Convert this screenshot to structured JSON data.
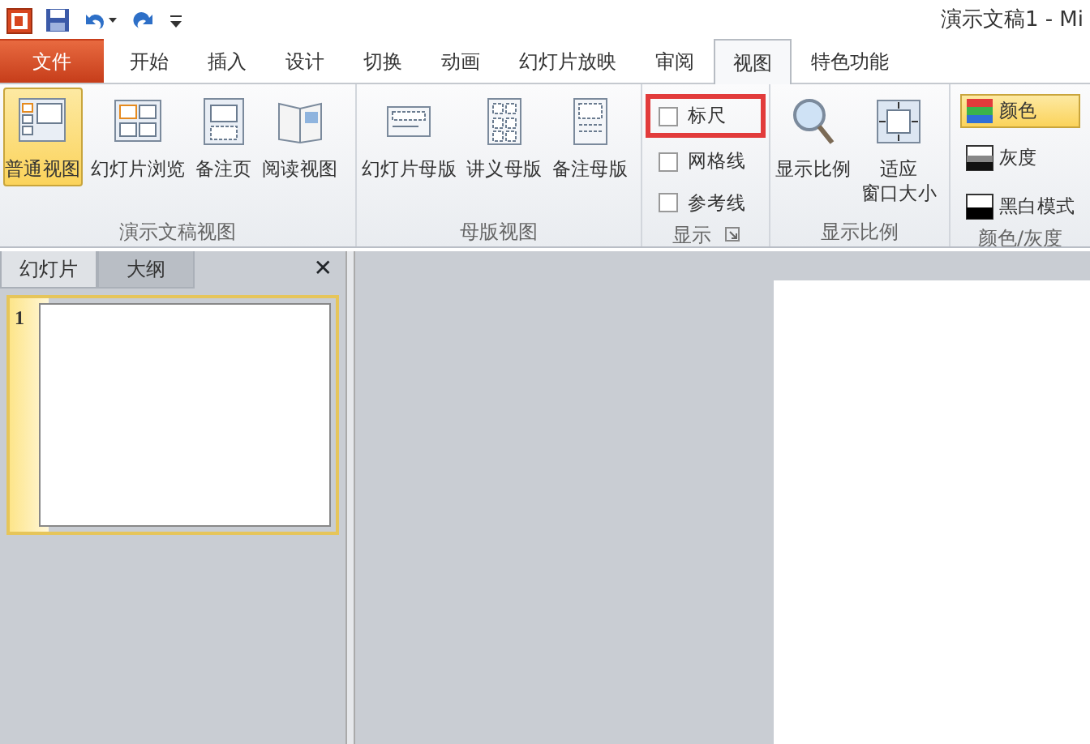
{
  "window": {
    "title": "演示文稿1 - Mi"
  },
  "tabs": [
    {
      "label": "文件",
      "kind": "file",
      "selected": false
    },
    {
      "label": "开始",
      "kind": "tab",
      "selected": false
    },
    {
      "label": "插入",
      "kind": "tab",
      "selected": false
    },
    {
      "label": "设计",
      "kind": "tab",
      "selected": false
    },
    {
      "label": "切换",
      "kind": "tab",
      "selected": false
    },
    {
      "label": "动画",
      "kind": "tab",
      "selected": false
    },
    {
      "label": "幻灯片放映",
      "kind": "tab",
      "selected": false
    },
    {
      "label": "审阅",
      "kind": "tab",
      "selected": false
    },
    {
      "label": "视图",
      "kind": "tab",
      "selected": true
    },
    {
      "label": "特色功能",
      "kind": "tab",
      "selected": false
    }
  ],
  "ribbon_groups": [
    {
      "label": "演示文稿视图",
      "kind": "large",
      "items": [
        {
          "label": "普通视图",
          "selected": true
        },
        {
          "label": "幻灯片浏览",
          "selected": false
        },
        {
          "label": "备注页",
          "selected": false
        },
        {
          "label": "阅读视图",
          "selected": false
        }
      ]
    },
    {
      "label": "母版视图",
      "kind": "large",
      "items": [
        {
          "label": "幻灯片母版",
          "selected": false
        },
        {
          "label": "讲义母版",
          "selected": false
        },
        {
          "label": "备注母版",
          "selected": false
        }
      ]
    },
    {
      "label": "显示",
      "kind": "checks",
      "items": [
        {
          "label": "标尺",
          "checked": false,
          "highlighted": true
        },
        {
          "label": "网格线",
          "checked": false,
          "highlighted": false
        },
        {
          "label": "参考线",
          "checked": false,
          "highlighted": false
        }
      ]
    },
    {
      "label": "显示比例",
      "kind": "large",
      "items": [
        {
          "label": "显示比例",
          "selected": false
        },
        {
          "lines": [
            "适应",
            "窗口大小"
          ],
          "selected": false
        }
      ]
    },
    {
      "label": "颜色/灰度",
      "kind": "small",
      "items": [
        {
          "label": "颜色",
          "selected": true
        },
        {
          "label": "灰度",
          "selected": false
        },
        {
          "label": "黑白模式",
          "selected": false
        }
      ]
    }
  ],
  "pane": {
    "tabs": [
      {
        "label": "幻灯片",
        "selected": true
      },
      {
        "label": "大纲",
        "selected": false
      }
    ],
    "close": "✕",
    "slides": [
      {
        "number": "1",
        "selected": true
      }
    ]
  }
}
